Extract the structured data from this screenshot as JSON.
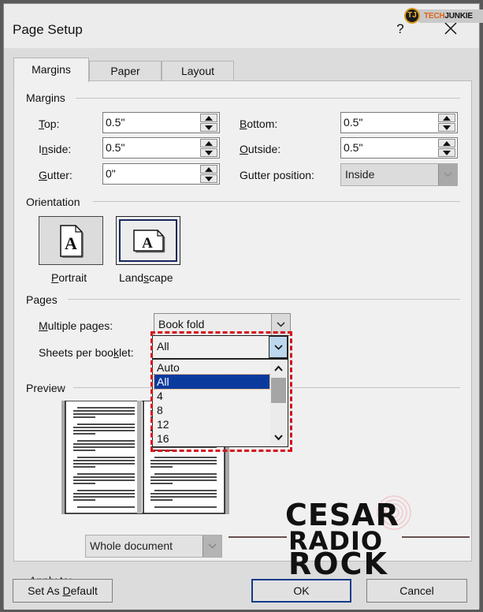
{
  "window": {
    "title": "Page Setup",
    "help_label": "?",
    "close_icon": "close-x-icon"
  },
  "watermarks": {
    "techjunkie": {
      "monogram": "TJ",
      "brand_part1": "TECH",
      "brand_part2": "JUNKIE",
      "accent": "#e2631b"
    },
    "radio": {
      "line1": "CESAR",
      "line2": "RADIO",
      "line3": "ROCK"
    }
  },
  "tabs": [
    {
      "label": "Margins",
      "active": true
    },
    {
      "label": "Paper",
      "active": false
    },
    {
      "label": "Layout",
      "active": false
    }
  ],
  "margins": {
    "group_label": "Margins",
    "top": {
      "label": "Top:",
      "accesskey": "T",
      "value": "0.5\""
    },
    "bottom": {
      "label": "Bottom:",
      "accesskey": "B",
      "value": "0.5\""
    },
    "inside": {
      "label": "Inside:",
      "accesskey": "n",
      "value": "0.5\""
    },
    "outside": {
      "label": "Outside:",
      "accesskey": "O",
      "value": "0.5\""
    },
    "gutter": {
      "label": "Gutter:",
      "accesskey": "G",
      "value": "0\""
    },
    "gutter_position": {
      "label": "Gutter position:",
      "value": "Inside",
      "disabled": true
    }
  },
  "orientation": {
    "group_label": "Orientation",
    "portrait": {
      "label": "Portrait",
      "accesskey": "P",
      "selected": false,
      "icon": "portrait-page-icon"
    },
    "landscape": {
      "label": "Landscape",
      "accesskey": "s",
      "selected": true,
      "icon": "landscape-page-icon"
    }
  },
  "pages": {
    "group_label": "Pages",
    "multiple_pages": {
      "label": "Multiple pages:",
      "accesskey": "M",
      "value": "Book fold"
    },
    "sheets_per_booklet": {
      "label": "Sheets per booklet:",
      "accesskey": "k",
      "value": "All",
      "open": true,
      "options": [
        "Auto",
        "All",
        "4",
        "8",
        "12",
        "16"
      ],
      "selected_index": 1
    }
  },
  "preview": {
    "group_label": "Preview"
  },
  "apply_to": {
    "label": "Apply to:",
    "value": "Whole document"
  },
  "buttons": {
    "set_default": "Set As Default",
    "set_default_accesskey": "D",
    "ok": "OK",
    "cancel": "Cancel"
  },
  "colors": {
    "highlight_border": "#d5121c",
    "list_selection": "#0a3a9d",
    "default_button_border": "#163a8a"
  }
}
